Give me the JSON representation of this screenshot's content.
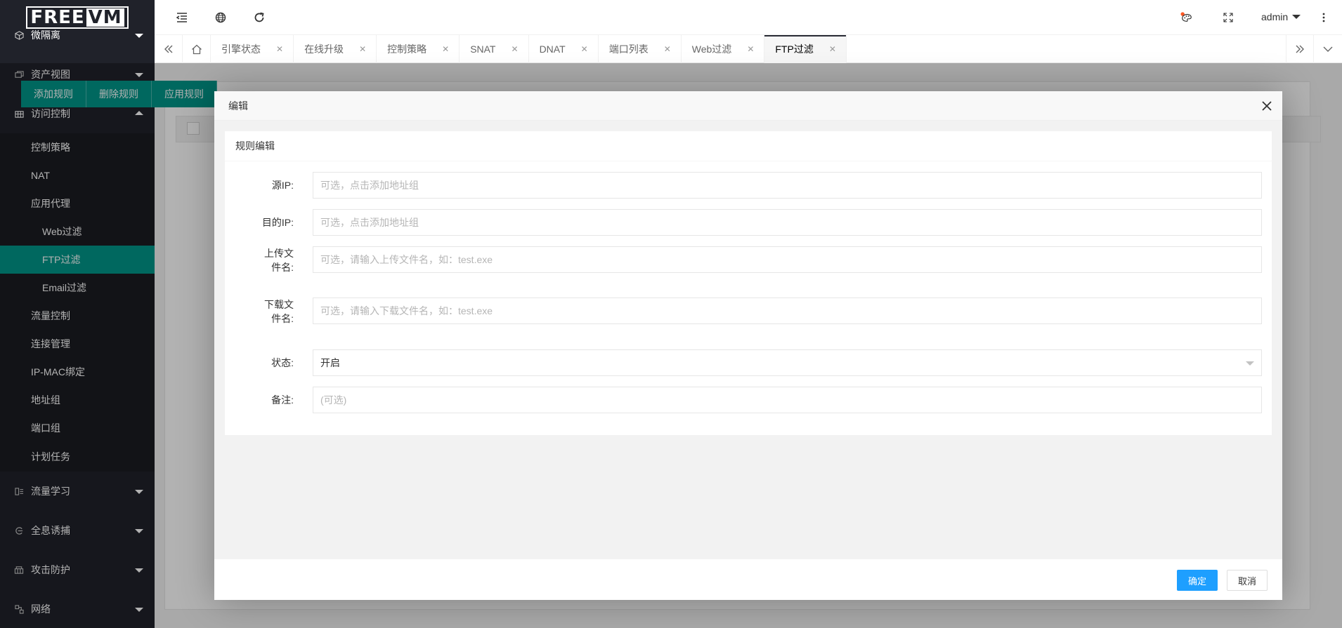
{
  "logo": {
    "part1": "FREE",
    "part2": "VM"
  },
  "sidebar": {
    "top_partial": "微隔离",
    "items": [
      {
        "label": "资产视图",
        "icon": "asset-icon",
        "state": "collapsed"
      },
      {
        "label": "访问控制",
        "icon": "grid-icon",
        "state": "expanded"
      }
    ],
    "access_control_children": {
      "policy": "控制策略",
      "nat": "NAT",
      "proxy": "应用代理",
      "proxy_children": [
        "Web过滤",
        "FTP过滤",
        "Email过滤"
      ],
      "rest": [
        "流量控制",
        "连接管理",
        "IP-MAC绑定",
        "地址组",
        "端口组",
        "计划任务"
      ]
    },
    "bottom_items": [
      {
        "label": "流量学习",
        "icon": "traffic-learn-icon"
      },
      {
        "label": "全息诱捕",
        "icon": "trap-icon"
      },
      {
        "label": "攻击防护",
        "icon": "shield-icon"
      },
      {
        "label": "网络",
        "icon": "network-icon"
      }
    ],
    "active_item": "FTP过滤"
  },
  "header": {
    "user": "admin"
  },
  "tabs": {
    "items": [
      "引擎状态",
      "在线升级",
      "控制策略",
      "SNAT",
      "DNAT",
      "端口列表",
      "Web过滤",
      "FTP过滤"
    ],
    "active": "FTP过滤",
    "close_glyph": "✕"
  },
  "background": {
    "buttons": [
      "添加规则",
      "删除规则",
      "应用规则"
    ]
  },
  "modal": {
    "title": "编辑",
    "panel_title": "规则编辑",
    "fields": {
      "src_ip": {
        "label": "源IP:",
        "placeholder": "可选，点击添加地址组"
      },
      "dst_ip": {
        "label": "目的IP:",
        "placeholder": "可选，点击添加地址组"
      },
      "upload": {
        "label": "上传文件名:",
        "placeholder": "可选，请输入上传文件名，如：test.exe"
      },
      "download": {
        "label": "下载文件名:",
        "placeholder": "可选，请输入下载文件名，如：test.exe"
      },
      "status": {
        "label": "状态:",
        "value": "开启"
      },
      "remark": {
        "label": "备注:",
        "placeholder": "(可选)"
      }
    },
    "ok": "确定",
    "cancel": "取消"
  },
  "colors": {
    "sidebar_bg": "#20222a",
    "accent": "#009688",
    "primary_button": "#1e9fff"
  }
}
